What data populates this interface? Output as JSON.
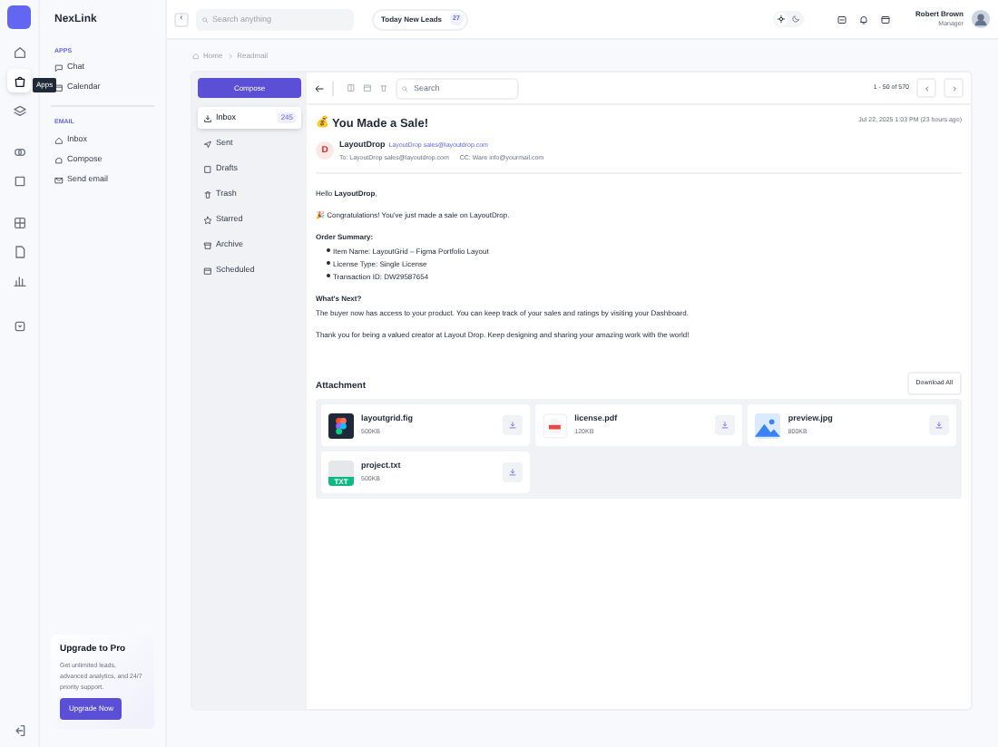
{
  "rail": [
    {
      "selected": false
    },
    {
      "selected": true
    },
    {
      "selected": false
    },
    {
      "selected": false
    },
    {
      "selected": false
    },
    {
      "selected": false
    },
    {
      "selected": false
    },
    {
      "selected": false
    },
    {
      "selected": false
    }
  ],
  "rail_tooltip": "Apps",
  "brand": "NexLink",
  "sidebar": {
    "sections": [
      {
        "title": "APPS",
        "items": [
          {
            "label": "Chat"
          },
          {
            "label": "Calendar"
          }
        ]
      },
      {
        "title": "EMAIL",
        "items": [
          {
            "label": "Inbox"
          },
          {
            "label": "Compose"
          },
          {
            "label": "Send email"
          }
        ]
      }
    ],
    "promo": {
      "title": "Upgrade to Pro",
      "text": "Get unlimited leads, advanced analytics, and 24/7 priority support.",
      "button": "Upgrade Now"
    }
  },
  "header": {
    "collapse": "‹",
    "search_placeholder": "Search anything",
    "leads_label": "Today New Leads",
    "leads_count": "27",
    "dark_mode": false,
    "user_name": "Robert Brown",
    "user_role": "Manager"
  },
  "breadcrumb": [
    "Home",
    "Readmail"
  ],
  "compose": "Compose",
  "folders": [
    {
      "label": "Inbox",
      "badge": "245",
      "selected": true
    },
    {
      "label": "Sent",
      "selected": false
    },
    {
      "label": "Drafts",
      "selected": false
    },
    {
      "label": "Trash",
      "selected": false
    },
    {
      "label": "Starred",
      "selected": false
    },
    {
      "label": "Archive",
      "selected": false
    },
    {
      "label": "Scheduled",
      "selected": false
    }
  ],
  "toolbar": {
    "search_placeholder": "Search",
    "pager": "1 - 50 of 570"
  },
  "mail": {
    "emoji": "💰",
    "subject": "You Made a Sale!",
    "date": "Jul 22, 2025 1:03 PM (23 hours ago)",
    "avatar": "D",
    "sender": "LayoutDrop",
    "from_link": "LayoutDrop sales@layoutdrop.com",
    "to": "To: LayoutDrop sales@layoutdrop.com",
    "cc": "CC: Ware info@yourmail.com",
    "body": [
      {
        "kind": "para",
        "text": "Hello **LayoutDrop**,"
      },
      {
        "kind": "para",
        "text": "🎉 Congratulations! You've just made a sale on LayoutDrop."
      },
      {
        "kind": "heading",
        "text": "Order Summary:"
      },
      {
        "kind": "list",
        "items": [
          "Item Name: LayoutGrid – Figma Portfolio Layout",
          "License Type: Single License",
          "Transaction ID: DW29587654"
        ]
      },
      {
        "kind": "heading",
        "text": "What's Next?"
      },
      {
        "kind": "para",
        "text": "The buyer now has access to your product. You can keep track of your sales and ratings by visiting your Dashboard."
      },
      {
        "kind": "para",
        "text": "Thank you for being a valued creator at Layout Drop. Keep designing and sharing your amazing work with the world!"
      }
    ]
  },
  "attachments": {
    "title": "Attachment",
    "download_all": "Download All",
    "files": [
      {
        "kind": "fig",
        "name": "layoutgrid.fig",
        "size": "500KB"
      },
      {
        "kind": "pdf",
        "name": "license.pdf",
        "size": "120KB"
      },
      {
        "kind": "image",
        "name": "preview.jpg",
        "size": "800KB"
      },
      {
        "kind": "txt",
        "name": "project.txt",
        "size": "500KB",
        "badge": "TXT"
      }
    ]
  }
}
